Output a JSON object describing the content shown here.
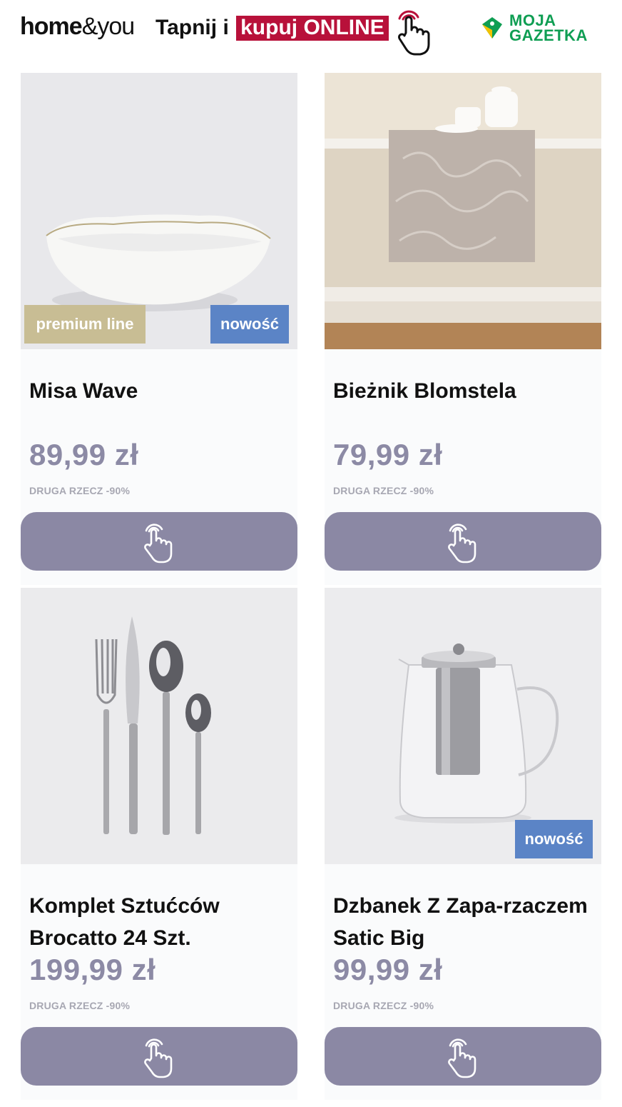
{
  "header": {
    "brand_bold": "home",
    "brand_light": "&you",
    "tap_prefix": "Tapnij i",
    "tap_highlight": "kupuj ONLINE",
    "partner": [
      "MOJA",
      "GAZETKA"
    ],
    "icons": [
      "tap-hand-icon",
      "gazetka-logo-icon"
    ],
    "colors": {
      "highlight": "#b8113a",
      "partner": "#0f9e53"
    }
  },
  "products": [
    {
      "title": "Misa Wave",
      "price": "89,99 zł",
      "note": "DRUGA RZECZ -90%",
      "badges": {
        "premium": "premium line",
        "new": "nowość"
      },
      "image": "white-bowl-image"
    },
    {
      "title": "Bieżnik Blomstela",
      "price": "79,99 zł",
      "note": "DRUGA RZECZ -90%",
      "image": "table-runner-image"
    },
    {
      "title": "Komplet Sztućców Brocatto 24 Szt.",
      "price": "199,99 zł",
      "note": "DRUGA RZECZ -90%",
      "image": "cutlery-set-image"
    },
    {
      "title": "Dzbanek Z Zapa-rzaczem Satic Big",
      "price": "99,99 zł",
      "note": "DRUGA RZECZ -90%",
      "badges": {
        "new": "nowość"
      },
      "image": "glass-teapot-image"
    }
  ],
  "colors": {
    "price": "#8c8aa5",
    "button": "#8b88a4",
    "premium_badge": "#c8bd94",
    "new_badge": "#5b84c6"
  }
}
